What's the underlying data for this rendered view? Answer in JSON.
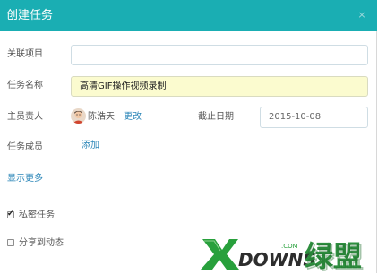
{
  "dialog": {
    "title": "创建任务",
    "close_glyph": "×"
  },
  "form": {
    "project_label": "关联项目",
    "project_value": "",
    "task_name_label": "任务名称",
    "task_name_value": "高清GIF操作视频录制",
    "owner_label": "主员责人",
    "owner_name": "陈浩天",
    "change_link": "更改",
    "due_date_label": "截止日期",
    "due_date_value": "2015-10-08",
    "members_label": "任务成员",
    "add_link": "添加",
    "show_more_link": "显示更多",
    "private_label": "私密任务",
    "private_checked": true,
    "share_label": "分享到动态",
    "share_checked": false
  },
  "watermark": {
    "text": "DOWNS绿盟",
    "com": ".COM"
  },
  "colors": {
    "header": "#1aaeb3",
    "link": "#2b86b8",
    "task_name_bg": "#fbfbcf"
  }
}
